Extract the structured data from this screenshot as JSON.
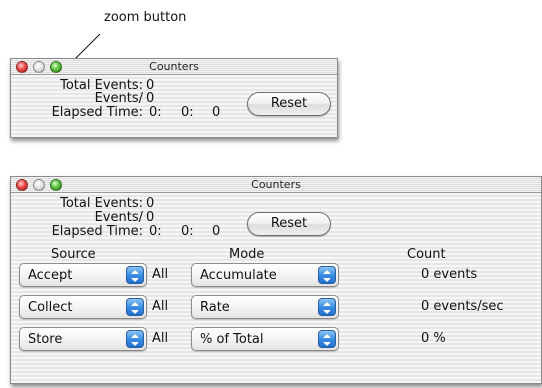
{
  "annotation": {
    "callout": "zoom button"
  },
  "small_window": {
    "title": "Counters",
    "stats": {
      "total_events_label": "Total Events:",
      "total_events_value": "0",
      "events_per_label": "Events/",
      "events_per_value": "0",
      "elapsed_label": "Elapsed Time:",
      "elapsed_h": "0:",
      "elapsed_m": "0:",
      "elapsed_s": "0"
    },
    "reset_label": "Reset"
  },
  "large_window": {
    "title": "Counters",
    "stats": {
      "total_events_label": "Total Events:",
      "total_events_value": "0",
      "events_per_label": "Events/",
      "events_per_value": "0",
      "elapsed_label": "Elapsed Time:",
      "elapsed_h": "0:",
      "elapsed_m": "0:",
      "elapsed_s": "0"
    },
    "reset_label": "Reset",
    "headers": {
      "source": "Source",
      "mode": "Mode",
      "count": "Count"
    },
    "rows": [
      {
        "source": "Accept",
        "all": "All",
        "mode": "Accumulate",
        "count": "0 events"
      },
      {
        "source": "Collect",
        "all": "All",
        "mode": "Rate",
        "count": "0 events/sec"
      },
      {
        "source": "Store",
        "all": "All",
        "mode": "% of Total",
        "count": "0 %"
      }
    ]
  },
  "colors": {
    "close_button": "#ee4a4a",
    "zoom_button": "#5bc23e",
    "popup_arrows": "#3b8de4"
  }
}
